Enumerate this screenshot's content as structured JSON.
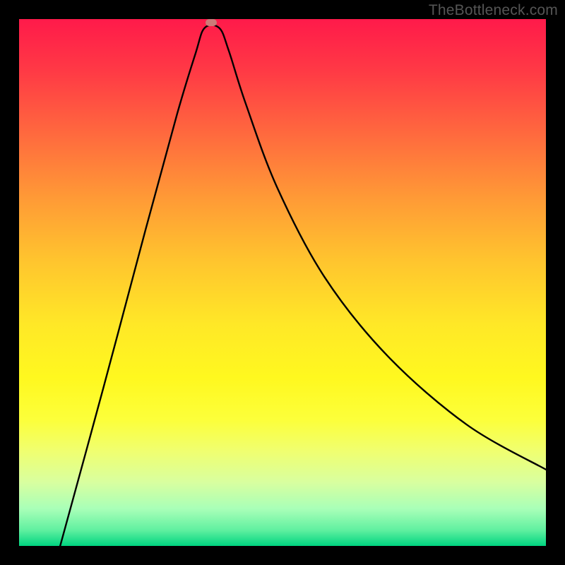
{
  "watermark": "TheBottleneck.com",
  "chart_data": {
    "type": "line",
    "title": "",
    "xlabel": "",
    "ylabel": "",
    "xlim": [
      0,
      100
    ],
    "ylim": [
      0,
      100
    ],
    "gradient_legend": [
      "green (good)",
      "yellow",
      "orange",
      "red (bad)"
    ],
    "marker": {
      "x_pct": 36.5,
      "y_pct": 99.3
    },
    "curve_points": [
      {
        "x_pct": 7.8,
        "y_pct": 0.0
      },
      {
        "x_pct": 16.0,
        "y_pct": 30.0
      },
      {
        "x_pct": 24.0,
        "y_pct": 60.0
      },
      {
        "x_pct": 30.0,
        "y_pct": 82.0
      },
      {
        "x_pct": 33.5,
        "y_pct": 93.5
      },
      {
        "x_pct": 35.2,
        "y_pct": 98.3
      },
      {
        "x_pct": 38.0,
        "y_pct": 98.3
      },
      {
        "x_pct": 39.8,
        "y_pct": 94.0
      },
      {
        "x_pct": 43.0,
        "y_pct": 84.0
      },
      {
        "x_pct": 49.0,
        "y_pct": 68.0
      },
      {
        "x_pct": 58.0,
        "y_pct": 51.0
      },
      {
        "x_pct": 70.0,
        "y_pct": 36.0
      },
      {
        "x_pct": 85.0,
        "y_pct": 23.0
      },
      {
        "x_pct": 100.0,
        "y_pct": 14.5
      }
    ]
  }
}
